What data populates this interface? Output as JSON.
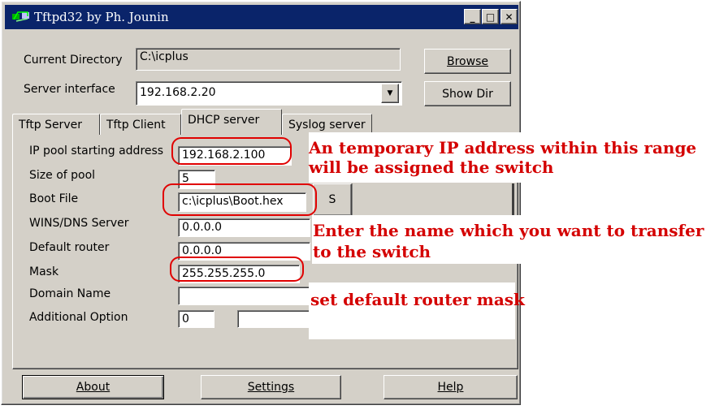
{
  "window": {
    "title": "Tftpd32 by Ph. Jounin",
    "minimize_glyph": "_",
    "maximize_glyph": "□",
    "close_glyph": "✕"
  },
  "top": {
    "current_dir_label": "Current Directory",
    "current_dir_value": "C:\\icplus",
    "server_interface_label": "Server interface",
    "server_interface_value": "192.168.2.20",
    "browse_label": "Browse",
    "showdir_label": "Show Dir"
  },
  "tabs": [
    {
      "label": "Tftp Server"
    },
    {
      "label": "Tftp Client"
    },
    {
      "label": "DHCP server"
    },
    {
      "label": "Syslog server"
    }
  ],
  "dhcp": {
    "ip_pool_label": "IP pool starting address",
    "ip_pool_value": "192.168.2.100",
    "size_label": "Size of pool",
    "size_value": "5",
    "boot_label": "Boot File",
    "boot_value": "c:\\icplus\\Boot.hex",
    "wins_label": "WINS/DNS Server",
    "wins_value": "0.0.0.0",
    "router_label": "Default router",
    "router_value": "0.0.0.0",
    "mask_label": "Mask",
    "mask_value": "255.255.255.0",
    "domain_label": "Domain Name",
    "domain_value": "",
    "addopt_label": "Additional Option",
    "addopt_value": "0",
    "addopt_value2": "",
    "s_button_label": "S"
  },
  "bottom": {
    "about_label": "About",
    "settings_label": "Settings",
    "help_label": "Help"
  },
  "annotations": {
    "ip_range_line1": "An temporary IP address within this range",
    "ip_range_line2": "will be assigned the switch",
    "boot_line1": "Enter the name which you want to transfer",
    "boot_line2": "to the switch",
    "mask_line1": "set default router mask"
  },
  "colors": {
    "titlebar": "#0a246a",
    "window_face": "#d4d0c8",
    "annotation": "#d40000"
  }
}
